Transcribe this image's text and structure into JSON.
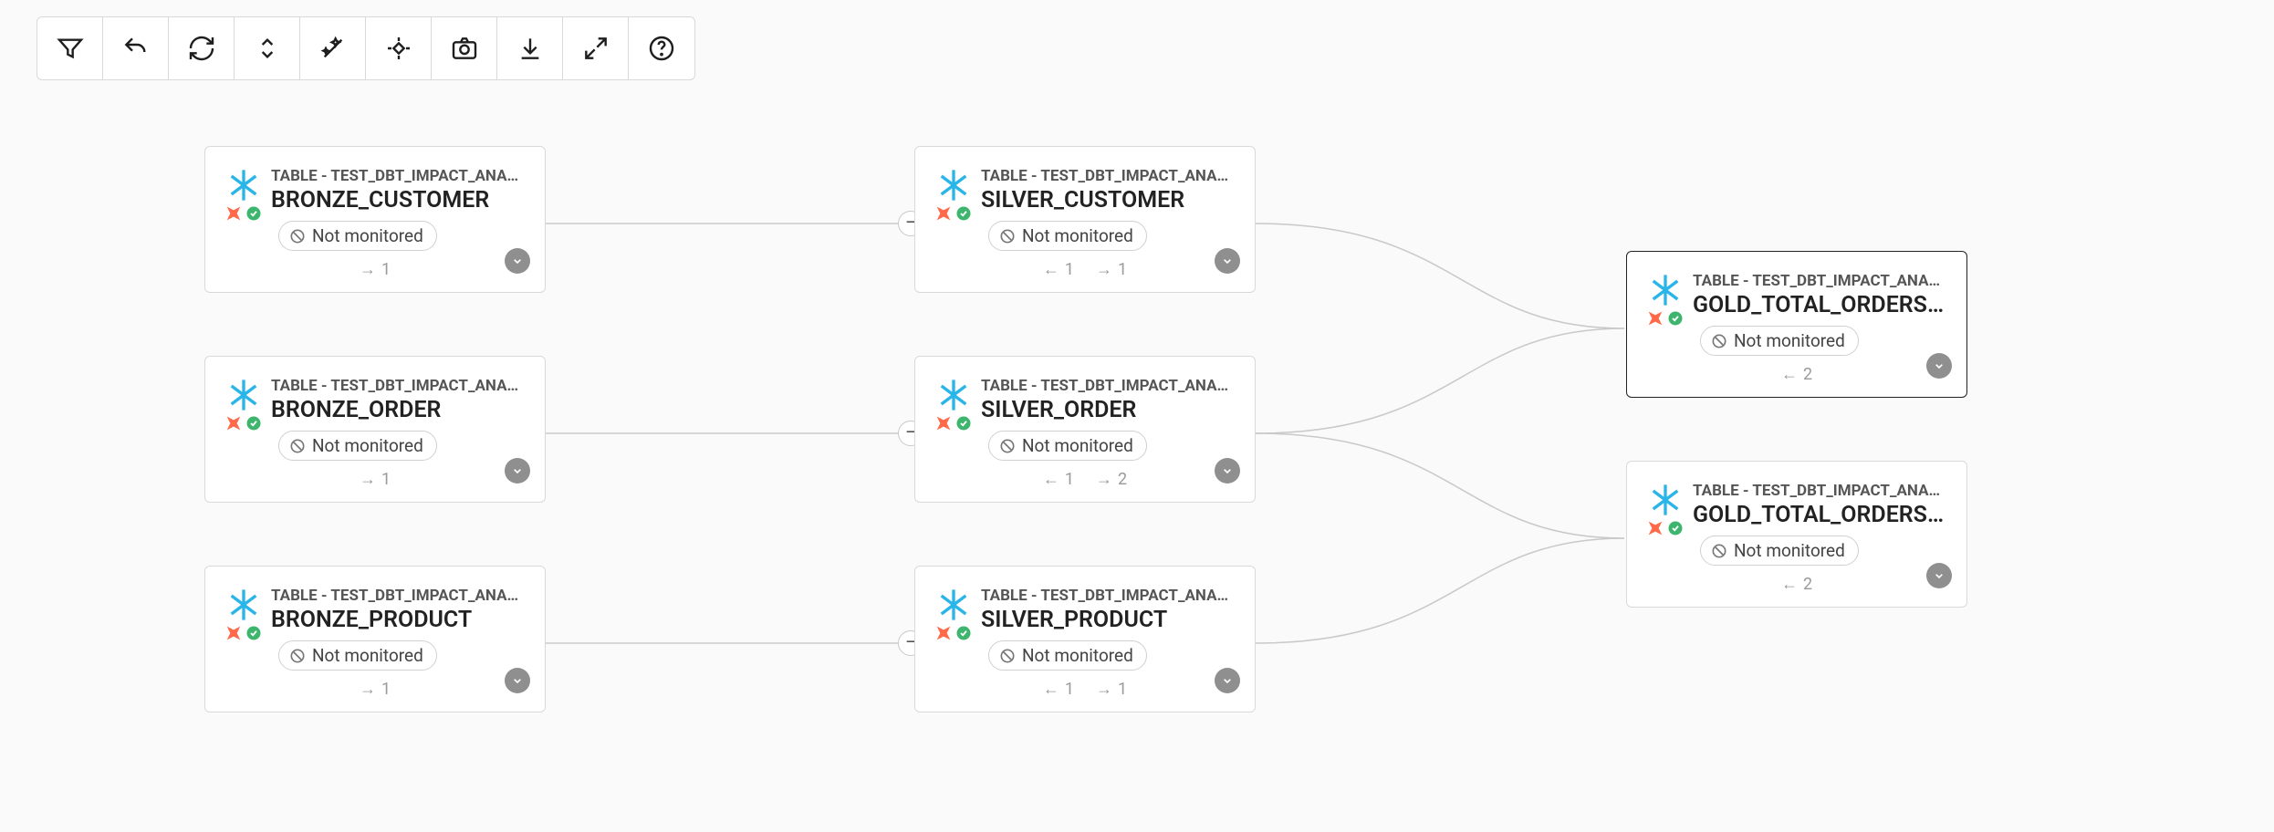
{
  "toolbar": {
    "buttons": [
      "filter",
      "undo",
      "refresh",
      "sort",
      "magic",
      "focus",
      "camera",
      "download",
      "expand",
      "help"
    ]
  },
  "status_label": "Not monitored",
  "nodes": {
    "bronze_customer": {
      "kicker": "TABLE - TEST_DBT_IMPACT_ANAL...",
      "title": "BRONZE_CUSTOMER",
      "outgoing": "1"
    },
    "bronze_order": {
      "kicker": "TABLE - TEST_DBT_IMPACT_ANAL...",
      "title": "BRONZE_ORDER",
      "outgoing": "1"
    },
    "bronze_product": {
      "kicker": "TABLE - TEST_DBT_IMPACT_ANAL...",
      "title": "BRONZE_PRODUCT",
      "outgoing": "1"
    },
    "silver_customer": {
      "kicker": "TABLE - TEST_DBT_IMPACT_ANAL...",
      "title": "SILVER_CUSTOMER",
      "incoming": "1",
      "outgoing": "1"
    },
    "silver_order": {
      "kicker": "TABLE - TEST_DBT_IMPACT_ANAL...",
      "title": "SILVER_ORDER",
      "incoming": "1",
      "outgoing": "2"
    },
    "silver_product": {
      "kicker": "TABLE - TEST_DBT_IMPACT_ANAL...",
      "title": "SILVER_PRODUCT",
      "incoming": "1",
      "outgoing": "1"
    },
    "gold_top": {
      "kicker": "TABLE - TEST_DBT_IMPACT_ANAL...",
      "title": "GOLD_TOTAL_ORDERS...",
      "incoming": "2"
    },
    "gold_bottom": {
      "kicker": "TABLE - TEST_DBT_IMPACT_ANAL...",
      "title": "GOLD_TOTAL_ORDERS...",
      "incoming": "2"
    }
  },
  "edges": [
    {
      "from": "bronze_customer",
      "to": "silver_customer"
    },
    {
      "from": "bronze_order",
      "to": "silver_order"
    },
    {
      "from": "bronze_product",
      "to": "silver_product"
    },
    {
      "from": "silver_customer",
      "to": "gold_top"
    },
    {
      "from": "silver_order",
      "to": "gold_top"
    },
    {
      "from": "silver_order",
      "to": "gold_bottom"
    },
    {
      "from": "silver_product",
      "to": "gold_bottom"
    }
  ],
  "collapse_glyph": "−"
}
